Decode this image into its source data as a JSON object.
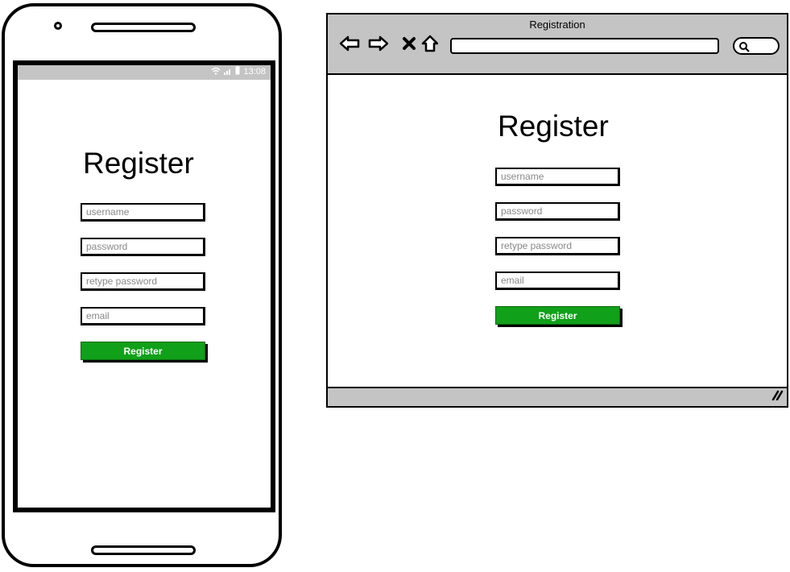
{
  "phone": {
    "status_time": "13:08",
    "heading": "Register",
    "fields": {
      "username_placeholder": "username",
      "password_placeholder": "password",
      "retype_placeholder": "retype password",
      "email_placeholder": "email"
    },
    "register_label": "Register"
  },
  "browser": {
    "title": "Registration",
    "nav_icons": [
      "back-arrow-icon",
      "forward-arrow-icon",
      "close-icon",
      "home-icon"
    ],
    "search_icon": "search-icon",
    "heading": "Register",
    "fields": {
      "username_placeholder": "username",
      "password_placeholder": "password",
      "retype_placeholder": "retype password",
      "email_placeholder": "email"
    },
    "register_label": "Register"
  },
  "colors": {
    "button_green": "#11a019",
    "chrome_gray": "#c4c4c4",
    "placeholder_gray": "#888888"
  }
}
